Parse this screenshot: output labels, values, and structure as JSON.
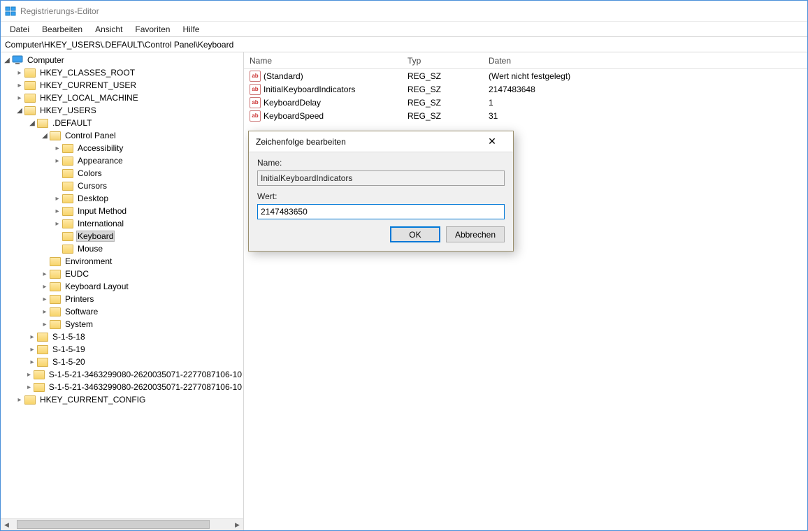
{
  "window": {
    "title": "Registrierungs-Editor"
  },
  "menubar": {
    "file": "Datei",
    "edit": "Bearbeiten",
    "view": "Ansicht",
    "favorites": "Favoriten",
    "help": "Hilfe"
  },
  "addressbar": {
    "path": "Computer\\HKEY_USERS\\.DEFAULT\\Control Panel\\Keyboard"
  },
  "tree": {
    "root": "Computer",
    "hkcr": "HKEY_CLASSES_ROOT",
    "hkcu": "HKEY_CURRENT_USER",
    "hklm": "HKEY_LOCAL_MACHINE",
    "hku": "HKEY_USERS",
    "hku_default": ".DEFAULT",
    "control_panel": "Control Panel",
    "cp_accessibility": "Accessibility",
    "cp_appearance": "Appearance",
    "cp_colors": "Colors",
    "cp_cursors": "Cursors",
    "cp_desktop": "Desktop",
    "cp_input_method": "Input Method",
    "cp_international": "International",
    "cp_keyboard": "Keyboard",
    "cp_mouse": "Mouse",
    "environment": "Environment",
    "eudc": "EUDC",
    "keyboard_layout": "Keyboard Layout",
    "printers": "Printers",
    "software": "Software",
    "system": "System",
    "s1518": "S-1-5-18",
    "s1519": "S-1-5-19",
    "s1520": "S-1-5-20",
    "sid_a": "S-1-5-21-3463299080-2620035071-2277087106-10",
    "sid_b": "S-1-5-21-3463299080-2620035071-2277087106-10",
    "hkcc": "HKEY_CURRENT_CONFIG"
  },
  "list": {
    "headers": {
      "name": "Name",
      "type": "Typ",
      "data": "Daten"
    },
    "rows": [
      {
        "name": "(Standard)",
        "type": "REG_SZ",
        "data": "(Wert nicht festgelegt)"
      },
      {
        "name": "InitialKeyboardIndicators",
        "type": "REG_SZ",
        "data": "2147483648"
      },
      {
        "name": "KeyboardDelay",
        "type": "REG_SZ",
        "data": "1"
      },
      {
        "name": "KeyboardSpeed",
        "type": "REG_SZ",
        "data": "31"
      }
    ]
  },
  "dialog": {
    "title": "Zeichenfolge bearbeiten",
    "name_label": "Name:",
    "name_value": "InitialKeyboardIndicators",
    "value_label": "Wert:",
    "value_value": "2147483650",
    "ok": "OK",
    "cancel": "Abbrechen"
  },
  "icons": {
    "value_glyph": "ab"
  }
}
